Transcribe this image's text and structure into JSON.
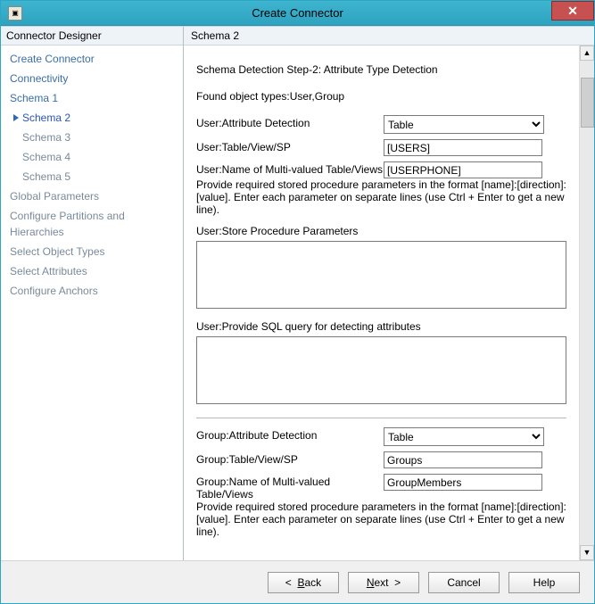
{
  "window": {
    "title": "Create Connector"
  },
  "sidebar": {
    "header": "Connector Designer",
    "items": [
      {
        "label": "Create Connector",
        "indent": false,
        "active": false,
        "greyed": false
      },
      {
        "label": "Connectivity",
        "indent": false,
        "active": false,
        "greyed": false
      },
      {
        "label": "Schema 1",
        "indent": false,
        "active": false,
        "greyed": false
      },
      {
        "label": "Schema 2",
        "indent": true,
        "active": true,
        "greyed": false
      },
      {
        "label": "Schema 3",
        "indent": true,
        "active": false,
        "greyed": true
      },
      {
        "label": "Schema 4",
        "indent": true,
        "active": false,
        "greyed": true
      },
      {
        "label": "Schema 5",
        "indent": true,
        "active": false,
        "greyed": true
      },
      {
        "label": "Global Parameters",
        "indent": false,
        "active": false,
        "greyed": true
      },
      {
        "label": "Configure Partitions and Hierarchies",
        "indent": false,
        "active": false,
        "greyed": true
      },
      {
        "label": "Select Object Types",
        "indent": false,
        "active": false,
        "greyed": true
      },
      {
        "label": "Select Attributes",
        "indent": false,
        "active": false,
        "greyed": true
      },
      {
        "label": "Configure Anchors",
        "indent": false,
        "active": false,
        "greyed": true
      }
    ]
  },
  "content": {
    "header": "Schema 2",
    "step_title": "Schema Detection Step-2: Attribute Type Detection",
    "found_types": "Found object types:User,Group",
    "user": {
      "attr_detection_label": "User:Attribute Detection",
      "attr_detection_value": "Table",
      "tableview_label": "User:Table/View/SP",
      "tableview_value": "[USERS]",
      "multivalued_label": "User:Name of Multi-valued Table/Views",
      "multivalued_value": "[USERPHONE]",
      "hint": "Provide required stored procedure parameters in the format [name]:[direction]:[value]. Enter each parameter on separate lines (use Ctrl + Enter to get a new line).",
      "sp_label": "User:Store Procedure Parameters",
      "sp_value": "",
      "sql_label": "User:Provide SQL query for detecting attributes",
      "sql_value": ""
    },
    "group": {
      "attr_detection_label": "Group:Attribute Detection",
      "attr_detection_value": "Table",
      "tableview_label": "Group:Table/View/SP",
      "tableview_value": "Groups",
      "multivalued_label": "Group:Name of Multi-valued Table/Views",
      "multivalued_value": "GroupMembers",
      "hint": "Provide required stored procedure parameters in the format [name]:[direction]:[value]. Enter each parameter on separate lines (use Ctrl + Enter to get a new line)."
    }
  },
  "buttons": {
    "back": "Back",
    "next": "Next",
    "cancel": "Cancel",
    "help": "Help"
  }
}
